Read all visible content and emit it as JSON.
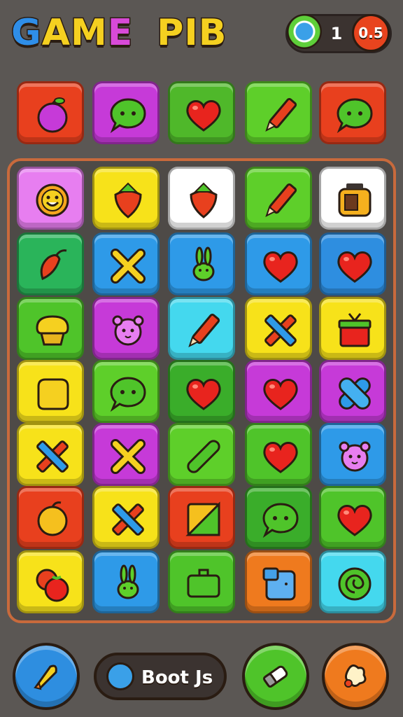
{
  "header": {
    "title_letters": [
      {
        "char": "G",
        "color": "#2f8ee8"
      },
      {
        "char": "A",
        "color": "#f5d020"
      },
      {
        "char": "M",
        "color": "#f5d020"
      },
      {
        "char": "E",
        "color": "#d84ad8"
      },
      {
        "char": "P",
        "color": "#f5d020"
      },
      {
        "char": "I",
        "color": "#f5d020"
      },
      {
        "char": "B",
        "color": "#f5d020"
      }
    ],
    "score_value": "1",
    "score_badge": "0.5"
  },
  "top_row": [
    {
      "color": "#e8401e",
      "icon": "plum-icon"
    },
    {
      "color": "#c63ad8",
      "icon": "speech-bubble-icon"
    },
    {
      "color": "#4fb82a",
      "icon": "heart-icon"
    },
    {
      "color": "#5ecf2a",
      "icon": "pencil-icon"
    },
    {
      "color": "#e8401e",
      "icon": "speech-bubble-icon"
    }
  ],
  "board": [
    [
      {
        "color": "#e77ef0",
        "icon": "sun-icon"
      },
      {
        "color": "#f7e21a",
        "icon": "strawberry-icon"
      },
      {
        "color": "#ffffff",
        "icon": "strawberry-icon"
      },
      {
        "color": "#5ecf2a",
        "icon": "pencil-icon"
      },
      {
        "color": "#ffffff",
        "icon": "toaster-icon"
      }
    ],
    [
      {
        "color": "#2ab45a",
        "icon": "chili-icon"
      },
      {
        "color": "#2e9ae8",
        "icon": "cross-icon"
      },
      {
        "color": "#2e9ae8",
        "icon": "bunny-icon"
      },
      {
        "color": "#2e9ae8",
        "icon": "heart-icon"
      },
      {
        "color": "#2e8ee0",
        "icon": "heart-icon"
      }
    ],
    [
      {
        "color": "#4fc42a",
        "icon": "muffin-icon"
      },
      {
        "color": "#c63ad8",
        "icon": "bear-icon"
      },
      {
        "color": "#44d8ee",
        "icon": "pencil-icon"
      },
      {
        "color": "#f7e21a",
        "icon": "cross-tools-icon"
      },
      {
        "color": "#f7e21a",
        "icon": "gift-icon"
      }
    ],
    [
      {
        "color": "#f7e21a",
        "icon": "cheese-icon"
      },
      {
        "color": "#5ecf2a",
        "icon": "speech-bubble-icon"
      },
      {
        "color": "#3aad2a",
        "icon": "heart-icon"
      },
      {
        "color": "#c63ad8",
        "icon": "heart-icon"
      },
      {
        "color": "#c63ad8",
        "icon": "bandage-icon"
      }
    ],
    [
      {
        "color": "#f7e21a",
        "icon": "cross-tools-icon"
      },
      {
        "color": "#c63ad8",
        "icon": "cross-icon"
      },
      {
        "color": "#5ecf2a",
        "icon": "pickle-icon"
      },
      {
        "color": "#4fc42a",
        "icon": "heart-icon"
      },
      {
        "color": "#2e9ae8",
        "icon": "bear-icon"
      }
    ],
    [
      {
        "color": "#e8401e",
        "icon": "lemon-icon"
      },
      {
        "color": "#f7e21a",
        "icon": "cross-tools-icon"
      },
      {
        "color": "#e8401e",
        "icon": "note-icon"
      },
      {
        "color": "#3aad2a",
        "icon": "speech-bubble-icon"
      },
      {
        "color": "#4fc42a",
        "icon": "heart-icon"
      }
    ],
    [
      {
        "color": "#f7e21a",
        "icon": "tomato-icon"
      },
      {
        "color": "#2e9ae8",
        "icon": "bunny-icon"
      },
      {
        "color": "#4fc42a",
        "icon": "battery-icon"
      },
      {
        "color": "#ef7a1e",
        "icon": "cube-icon"
      },
      {
        "color": "#44d8ee",
        "icon": "swirl-icon"
      }
    ]
  ],
  "bottom": {
    "left_button_icon": "rocket-icon",
    "boost_label": "Boot Js",
    "eraser_icon": "eraser-icon",
    "shuffle_icon": "splat-icon",
    "colors": {
      "left": "#2e8ee0",
      "eraser": "#4fc42a",
      "shuffle": "#ef7a1e"
    }
  }
}
